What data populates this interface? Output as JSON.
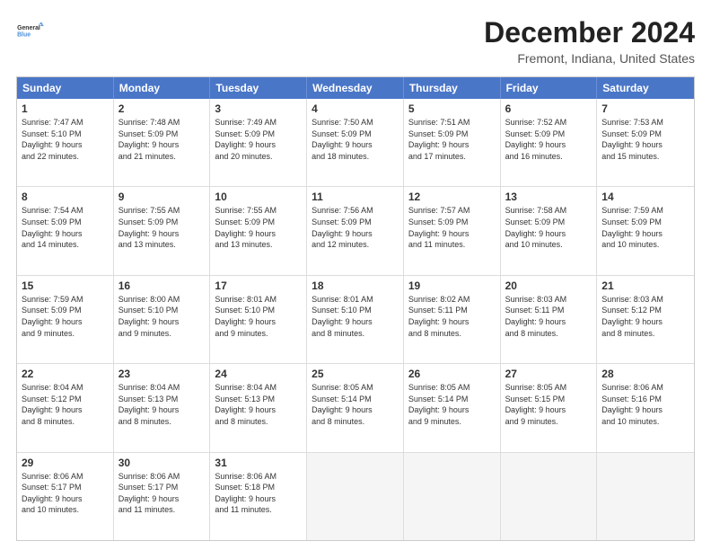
{
  "header": {
    "logo_line1": "General",
    "logo_line2": "Blue",
    "title": "December 2024",
    "subtitle": "Fremont, Indiana, United States"
  },
  "days_of_week": [
    "Sunday",
    "Monday",
    "Tuesday",
    "Wednesday",
    "Thursday",
    "Friday",
    "Saturday"
  ],
  "weeks": [
    [
      {
        "day": "1",
        "lines": [
          "Sunrise: 7:47 AM",
          "Sunset: 5:10 PM",
          "Daylight: 9 hours",
          "and 22 minutes."
        ]
      },
      {
        "day": "2",
        "lines": [
          "Sunrise: 7:48 AM",
          "Sunset: 5:09 PM",
          "Daylight: 9 hours",
          "and 21 minutes."
        ]
      },
      {
        "day": "3",
        "lines": [
          "Sunrise: 7:49 AM",
          "Sunset: 5:09 PM",
          "Daylight: 9 hours",
          "and 20 minutes."
        ]
      },
      {
        "day": "4",
        "lines": [
          "Sunrise: 7:50 AM",
          "Sunset: 5:09 PM",
          "Daylight: 9 hours",
          "and 18 minutes."
        ]
      },
      {
        "day": "5",
        "lines": [
          "Sunrise: 7:51 AM",
          "Sunset: 5:09 PM",
          "Daylight: 9 hours",
          "and 17 minutes."
        ]
      },
      {
        "day": "6",
        "lines": [
          "Sunrise: 7:52 AM",
          "Sunset: 5:09 PM",
          "Daylight: 9 hours",
          "and 16 minutes."
        ]
      },
      {
        "day": "7",
        "lines": [
          "Sunrise: 7:53 AM",
          "Sunset: 5:09 PM",
          "Daylight: 9 hours",
          "and 15 minutes."
        ]
      }
    ],
    [
      {
        "day": "8",
        "lines": [
          "Sunrise: 7:54 AM",
          "Sunset: 5:09 PM",
          "Daylight: 9 hours",
          "and 14 minutes."
        ]
      },
      {
        "day": "9",
        "lines": [
          "Sunrise: 7:55 AM",
          "Sunset: 5:09 PM",
          "Daylight: 9 hours",
          "and 13 minutes."
        ]
      },
      {
        "day": "10",
        "lines": [
          "Sunrise: 7:55 AM",
          "Sunset: 5:09 PM",
          "Daylight: 9 hours",
          "and 13 minutes."
        ]
      },
      {
        "day": "11",
        "lines": [
          "Sunrise: 7:56 AM",
          "Sunset: 5:09 PM",
          "Daylight: 9 hours",
          "and 12 minutes."
        ]
      },
      {
        "day": "12",
        "lines": [
          "Sunrise: 7:57 AM",
          "Sunset: 5:09 PM",
          "Daylight: 9 hours",
          "and 11 minutes."
        ]
      },
      {
        "day": "13",
        "lines": [
          "Sunrise: 7:58 AM",
          "Sunset: 5:09 PM",
          "Daylight: 9 hours",
          "and 10 minutes."
        ]
      },
      {
        "day": "14",
        "lines": [
          "Sunrise: 7:59 AM",
          "Sunset: 5:09 PM",
          "Daylight: 9 hours",
          "and 10 minutes."
        ]
      }
    ],
    [
      {
        "day": "15",
        "lines": [
          "Sunrise: 7:59 AM",
          "Sunset: 5:09 PM",
          "Daylight: 9 hours",
          "and 9 minutes."
        ]
      },
      {
        "day": "16",
        "lines": [
          "Sunrise: 8:00 AM",
          "Sunset: 5:10 PM",
          "Daylight: 9 hours",
          "and 9 minutes."
        ]
      },
      {
        "day": "17",
        "lines": [
          "Sunrise: 8:01 AM",
          "Sunset: 5:10 PM",
          "Daylight: 9 hours",
          "and 9 minutes."
        ]
      },
      {
        "day": "18",
        "lines": [
          "Sunrise: 8:01 AM",
          "Sunset: 5:10 PM",
          "Daylight: 9 hours",
          "and 8 minutes."
        ]
      },
      {
        "day": "19",
        "lines": [
          "Sunrise: 8:02 AM",
          "Sunset: 5:11 PM",
          "Daylight: 9 hours",
          "and 8 minutes."
        ]
      },
      {
        "day": "20",
        "lines": [
          "Sunrise: 8:03 AM",
          "Sunset: 5:11 PM",
          "Daylight: 9 hours",
          "and 8 minutes."
        ]
      },
      {
        "day": "21",
        "lines": [
          "Sunrise: 8:03 AM",
          "Sunset: 5:12 PM",
          "Daylight: 9 hours",
          "and 8 minutes."
        ]
      }
    ],
    [
      {
        "day": "22",
        "lines": [
          "Sunrise: 8:04 AM",
          "Sunset: 5:12 PM",
          "Daylight: 9 hours",
          "and 8 minutes."
        ]
      },
      {
        "day": "23",
        "lines": [
          "Sunrise: 8:04 AM",
          "Sunset: 5:13 PM",
          "Daylight: 9 hours",
          "and 8 minutes."
        ]
      },
      {
        "day": "24",
        "lines": [
          "Sunrise: 8:04 AM",
          "Sunset: 5:13 PM",
          "Daylight: 9 hours",
          "and 8 minutes."
        ]
      },
      {
        "day": "25",
        "lines": [
          "Sunrise: 8:05 AM",
          "Sunset: 5:14 PM",
          "Daylight: 9 hours",
          "and 8 minutes."
        ]
      },
      {
        "day": "26",
        "lines": [
          "Sunrise: 8:05 AM",
          "Sunset: 5:14 PM",
          "Daylight: 9 hours",
          "and 9 minutes."
        ]
      },
      {
        "day": "27",
        "lines": [
          "Sunrise: 8:05 AM",
          "Sunset: 5:15 PM",
          "Daylight: 9 hours",
          "and 9 minutes."
        ]
      },
      {
        "day": "28",
        "lines": [
          "Sunrise: 8:06 AM",
          "Sunset: 5:16 PM",
          "Daylight: 9 hours",
          "and 10 minutes."
        ]
      }
    ],
    [
      {
        "day": "29",
        "lines": [
          "Sunrise: 8:06 AM",
          "Sunset: 5:17 PM",
          "Daylight: 9 hours",
          "and 10 minutes."
        ]
      },
      {
        "day": "30",
        "lines": [
          "Sunrise: 8:06 AM",
          "Sunset: 5:17 PM",
          "Daylight: 9 hours",
          "and 11 minutes."
        ]
      },
      {
        "day": "31",
        "lines": [
          "Sunrise: 8:06 AM",
          "Sunset: 5:18 PM",
          "Daylight: 9 hours",
          "and 11 minutes."
        ]
      },
      {
        "day": "",
        "lines": []
      },
      {
        "day": "",
        "lines": []
      },
      {
        "day": "",
        "lines": []
      },
      {
        "day": "",
        "lines": []
      }
    ]
  ]
}
